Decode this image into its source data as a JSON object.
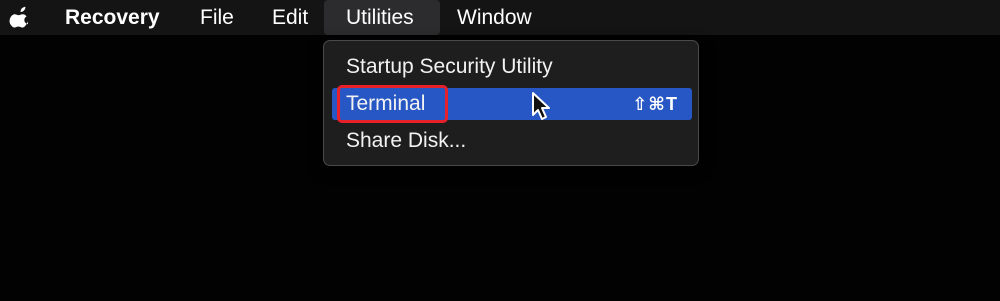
{
  "menubar": {
    "apple_icon": "apple-icon",
    "items": [
      {
        "label": "Recovery"
      },
      {
        "label": "File"
      },
      {
        "label": "Edit"
      },
      {
        "label": "Utilities"
      },
      {
        "label": "Window"
      }
    ]
  },
  "utilities_menu": {
    "items": [
      {
        "label": "Startup Security Utility",
        "shortcut": ""
      },
      {
        "label": "Terminal",
        "shortcut": "⇧⌘T"
      },
      {
        "label": "Share Disk...",
        "shortcut": ""
      }
    ],
    "highlighted_index": 1
  },
  "colors": {
    "menubar_bg": "#141414",
    "menu_bg": "#1e1e1e",
    "highlight": "#2757c4",
    "annotation_box": "#e8202a"
  },
  "icons": {
    "cursor": "pointer-cursor-icon"
  }
}
